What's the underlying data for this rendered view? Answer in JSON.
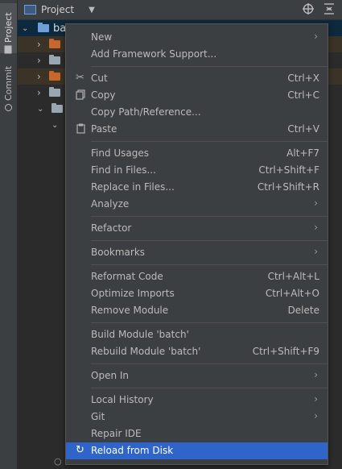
{
  "sidebar": {
    "project_tab": "Project",
    "commit_tab": "Commit"
  },
  "toolbar": {
    "title": "Project",
    "dropdown_icon": "chevron-down-icon",
    "icons": [
      "crosshair-icon",
      "collapse-all-icon"
    ]
  },
  "tree": {
    "root_label": "ba",
    "colors": {
      "accent_folder": "#c7672e",
      "plain_folder": "#9aa7b0",
      "root_folder": "#6f9fd8"
    }
  },
  "menu": {
    "items": [
      {
        "label": "New",
        "shortcut": "",
        "submenu": true,
        "icon": ""
      },
      {
        "label": "Add Framework Support...",
        "shortcut": "",
        "submenu": false,
        "icon": ""
      },
      {
        "label": "Cut",
        "shortcut": "Ctrl+X",
        "submenu": false,
        "icon": "scissors-icon"
      },
      {
        "label": "Copy",
        "shortcut": "Ctrl+C",
        "submenu": false,
        "icon": "copy-icon"
      },
      {
        "label": "Copy Path/Reference...",
        "shortcut": "",
        "submenu": false,
        "icon": ""
      },
      {
        "label": "Paste",
        "shortcut": "Ctrl+V",
        "submenu": false,
        "icon": "clipboard-icon"
      },
      {
        "label": "Find Usages",
        "shortcut": "Alt+F7",
        "submenu": false,
        "icon": ""
      },
      {
        "label": "Find in Files...",
        "shortcut": "Ctrl+Shift+F",
        "submenu": false,
        "icon": ""
      },
      {
        "label": "Replace in Files...",
        "shortcut": "Ctrl+Shift+R",
        "submenu": false,
        "icon": ""
      },
      {
        "label": "Analyze",
        "shortcut": "",
        "submenu": true,
        "icon": ""
      },
      {
        "label": "Refactor",
        "shortcut": "",
        "submenu": true,
        "icon": ""
      },
      {
        "label": "Bookmarks",
        "shortcut": "",
        "submenu": true,
        "icon": ""
      },
      {
        "label": "Reformat Code",
        "shortcut": "Ctrl+Alt+L",
        "submenu": false,
        "icon": ""
      },
      {
        "label": "Optimize Imports",
        "shortcut": "Ctrl+Alt+O",
        "submenu": false,
        "icon": ""
      },
      {
        "label": "Remove Module",
        "shortcut": "Delete",
        "submenu": false,
        "icon": ""
      },
      {
        "label": "Build Module 'batch'",
        "shortcut": "",
        "submenu": false,
        "icon": ""
      },
      {
        "label": "Rebuild Module 'batch'",
        "shortcut": "Ctrl+Shift+F9",
        "submenu": false,
        "icon": ""
      },
      {
        "label": "Open In",
        "shortcut": "",
        "submenu": true,
        "icon": ""
      },
      {
        "label": "Local History",
        "shortcut": "",
        "submenu": true,
        "icon": ""
      },
      {
        "label": "Git",
        "shortcut": "",
        "submenu": true,
        "icon": ""
      },
      {
        "label": "Repair IDE",
        "shortcut": "",
        "submenu": false,
        "icon": ""
      },
      {
        "label": "Reload from Disk",
        "shortcut": "",
        "submenu": false,
        "icon": "reload-icon",
        "selected": true
      }
    ],
    "colors": {
      "background": "#3c3f41",
      "selection": "#2f65ca",
      "text": "#bbbbbb"
    }
  }
}
